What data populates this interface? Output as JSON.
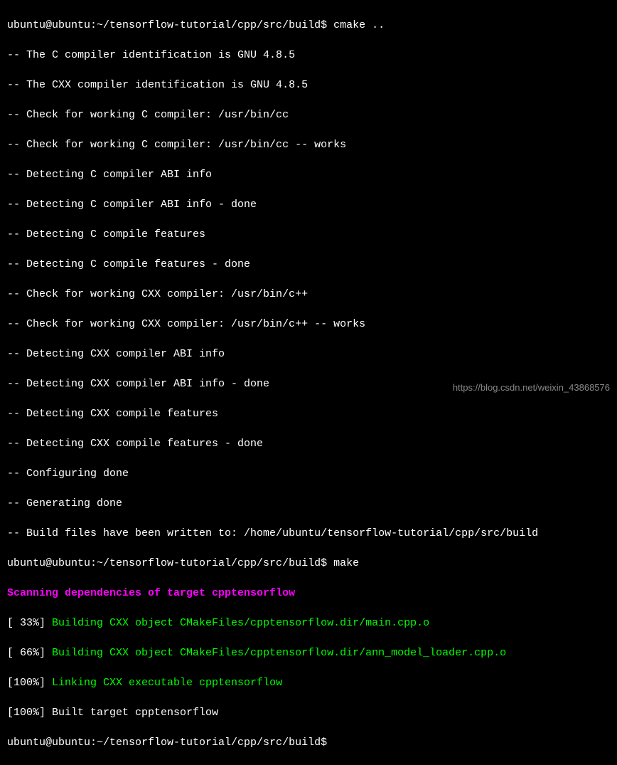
{
  "terminal": {
    "prompt1": "ubuntu@ubuntu:~/tensorflow-tutorial/cpp/src/build$ ",
    "command1": "cmake ..",
    "cmake_lines": [
      "-- The C compiler identification is GNU 4.8.5",
      "-- The CXX compiler identification is GNU 4.8.5",
      "-- Check for working C compiler: /usr/bin/cc",
      "-- Check for working C compiler: /usr/bin/cc -- works",
      "-- Detecting C compiler ABI info",
      "-- Detecting C compiler ABI info - done",
      "-- Detecting C compile features",
      "-- Detecting C compile features - done",
      "-- Check for working CXX compiler: /usr/bin/c++",
      "-- Check for working CXX compiler: /usr/bin/c++ -- works",
      "-- Detecting CXX compiler ABI info",
      "-- Detecting CXX compiler ABI info - done",
      "-- Detecting CXX compile features",
      "-- Detecting CXX compile features - done",
      "-- Configuring done",
      "-- Generating done",
      "-- Build files have been written to: /home/ubuntu/tensorflow-tutorial/cpp/src/build"
    ],
    "prompt2": "ubuntu@ubuntu:~/tensorflow-tutorial/cpp/src/build$ ",
    "command2": "make",
    "scanning_line": "Scanning dependencies of target cpptensorflow",
    "build_lines": [
      {
        "percent": "[ 33%] ",
        "text": "Building CXX object CMakeFiles/cpptensorflow.dir/main.cpp.o"
      },
      {
        "percent": "[ 66%] ",
        "text": "Building CXX object CMakeFiles/cpptensorflow.dir/ann_model_loader.cpp.o"
      },
      {
        "percent": "[100%] ",
        "text": "Linking CXX executable cpptensorflow"
      }
    ],
    "built_line": "[100%] Built target cpptensorflow",
    "prompt3": "ubuntu@ubuntu:~/tensorflow-tutorial/cpp/src/build$"
  },
  "watermark": "https://blog.csdn.net/weixin_43868576"
}
